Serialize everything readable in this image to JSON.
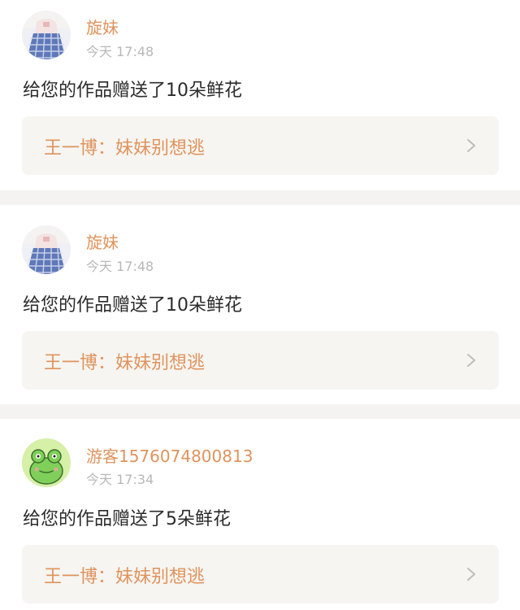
{
  "notifications": [
    {
      "username": "旋妹",
      "time": "今天 17:48",
      "message": "给您的作品赠送了10朵鲜花",
      "work_title": "王一博：妹妹别想逃",
      "avatar": "girl-plaid-skirt-avatar"
    },
    {
      "username": "旋妹",
      "time": "今天 17:48",
      "message": "给您的作品赠送了10朵鲜花",
      "work_title": "王一博：妹妹别想逃",
      "avatar": "girl-plaid-skirt-avatar"
    },
    {
      "username": "游客1576074800813",
      "time": "今天 17:34",
      "message": "给您的作品赠送了5朵鲜花",
      "work_title": "王一博：妹妹别想逃",
      "avatar": "frog-avatar"
    }
  ],
  "colors": {
    "accent": "#e0935d",
    "muted": "#b8b8b8",
    "text": "#2b2b2b",
    "card_link_bg": "#f6f5f1",
    "divider": "#f4f3f1"
  },
  "icons": {
    "chevron": "chevron-right-icon"
  }
}
